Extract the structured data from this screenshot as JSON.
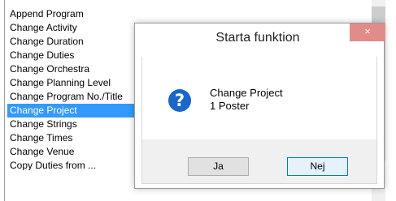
{
  "list": {
    "items": [
      {
        "label": "Append Program"
      },
      {
        "label": "Change Activity"
      },
      {
        "label": "Change Duration"
      },
      {
        "label": "Change Duties"
      },
      {
        "label": "Change Orchestra"
      },
      {
        "label": "Change Planning Level"
      },
      {
        "label": "Change Program No./Title"
      },
      {
        "label": "Change Project"
      },
      {
        "label": "Change Strings"
      },
      {
        "label": "Change Times"
      },
      {
        "label": "Change Venue"
      },
      {
        "label": "Copy Duties from ..."
      }
    ],
    "selected_index": 7
  },
  "dialog": {
    "title": "Starta funktion",
    "close_label": "×",
    "message_line1": "Change Project",
    "message_line2": "1 Poster",
    "icon": "question-icon",
    "yes_label": "Ja",
    "no_label": "Nej"
  },
  "colors": {
    "selection": "#3399ff",
    "icon_blue": "#1a66c9",
    "close_button": "#e28b8b",
    "default_button_border": "#0078d7"
  }
}
